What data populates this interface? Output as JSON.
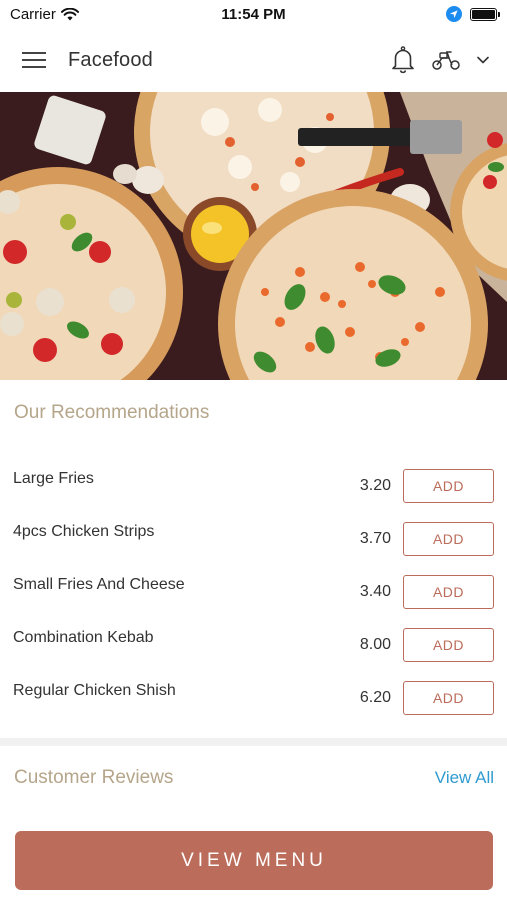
{
  "status_bar": {
    "carrier": "Carrier",
    "time": "11:54 PM",
    "icons": [
      "wifi-icon",
      "location-icon",
      "battery-icon"
    ]
  },
  "nav": {
    "title": "Facefood",
    "icons": [
      "hamburger-menu-icon",
      "bell-icon",
      "scooter-icon",
      "chevron-down-icon"
    ]
  },
  "hero": {
    "image_description": "pizza-banner"
  },
  "recommendations": {
    "title": "Our Recommendations",
    "items": [
      {
        "name": "Large Fries",
        "price": "3.20",
        "button": "ADD"
      },
      {
        "name": "4pcs Chicken Strips",
        "price": "3.70",
        "button": "ADD"
      },
      {
        "name": "Small Fries And Cheese",
        "price": "3.40",
        "button": "ADD"
      },
      {
        "name": "Combination Kebab",
        "price": "8.00",
        "button": "ADD"
      },
      {
        "name": "Regular Chicken Shish",
        "price": "6.20",
        "button": "ADD"
      }
    ]
  },
  "reviews": {
    "title": "Customer Reviews",
    "view_all": "View All"
  },
  "footer": {
    "view_menu": "VIEW MENU"
  },
  "colors": {
    "accent": "#bb6c5a",
    "section_title": "#b5a58a",
    "link": "#2f9bd0"
  }
}
